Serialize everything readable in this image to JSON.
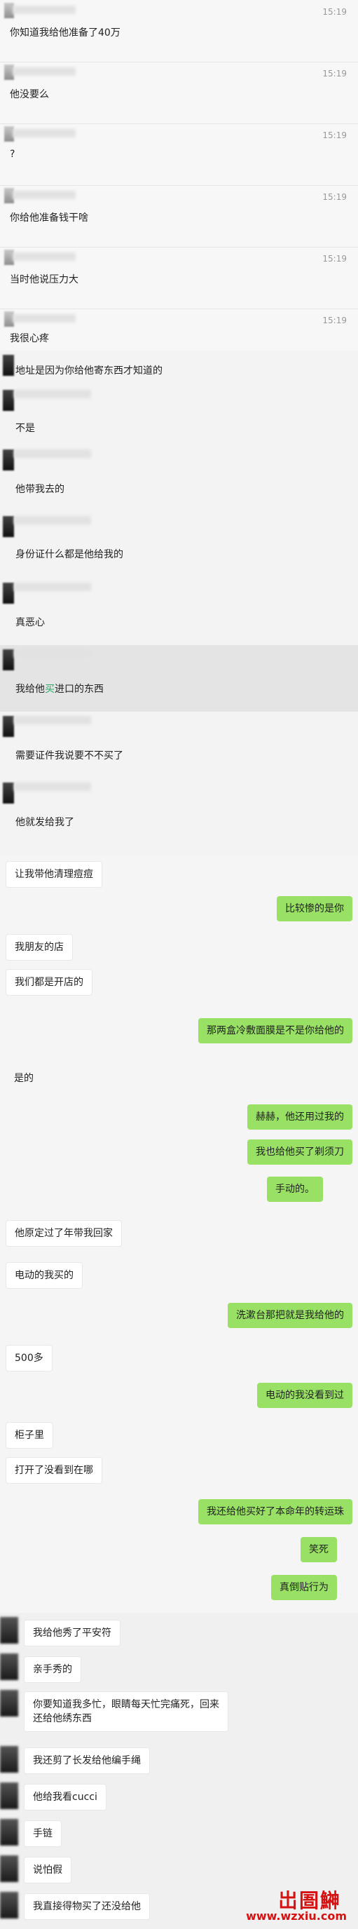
{
  "section1": [
    {
      "time": "15:19",
      "text": "你知道我给他准备了40万"
    },
    {
      "time": "15:19",
      "text": "他没要么"
    },
    {
      "time": "15:19",
      "text": "?"
    },
    {
      "time": "15:19",
      "text": "你给他准备钱干啥"
    },
    {
      "time": "15:19",
      "text": "当时他说压力大"
    },
    {
      "time": "15:19",
      "text": "我很心疼"
    }
  ],
  "section2": [
    {
      "text": "地址是因为你给他寄东西才知道的"
    },
    {
      "text": "不是"
    },
    {
      "text": "他带我去的"
    },
    {
      "text": "身份证什么都是他给我的"
    },
    {
      "text": "真恶心"
    },
    {
      "pre": "我给他",
      "accent": "买",
      "post": "进口的东西"
    },
    {
      "text": "需要证件我说要不不买了"
    },
    {
      "text": "他就发给我了"
    }
  ],
  "section3": [
    {
      "side": "l",
      "text": "让我带他清理痘痘"
    },
    {
      "side": "r",
      "text": "比较惨的是你"
    },
    {
      "side": "l",
      "text": "我朋友的店"
    },
    {
      "side": "l",
      "text": "我们都是开店的"
    },
    {
      "side": "r",
      "text": "那两盒冷敷面膜是不是你给他的"
    },
    {
      "side": "l",
      "text": "是的"
    },
    {
      "side": "r",
      "text": "赫赫，他还用过我的"
    },
    {
      "side": "r",
      "text": "我也给他买了剃须刀"
    },
    {
      "side": "r",
      "text": "手动的。"
    },
    {
      "side": "l",
      "text": "他原定过了年带我回家"
    },
    {
      "side": "l",
      "text": "电动的我买的"
    },
    {
      "side": "r",
      "text": "洗漱台那把就是我给他的"
    },
    {
      "side": "l",
      "text": "500多"
    },
    {
      "side": "r",
      "text": "电动的我没看到过"
    },
    {
      "side": "l",
      "text": "柜子里"
    },
    {
      "side": "l",
      "text": "打开了没看到在哪"
    },
    {
      "side": "r",
      "text": "我还给他买好了本命年的转运珠"
    },
    {
      "side": "r",
      "text": "笑死"
    },
    {
      "side": "r",
      "text": "真倒贴行为"
    }
  ],
  "section4": [
    {
      "text": "我给他秀了平安符"
    },
    {
      "text": "亲手秀的"
    },
    {
      "text": "你要知道我多忙，眼睛每天忙完痛死，回来\n还给他绣东西"
    },
    {
      "text": "我还剪了长发给他编手绳"
    },
    {
      "text": "他给我看cucci"
    },
    {
      "text": "手链"
    },
    {
      "text": "说怕假"
    },
    {
      "text": "我直接得物买了还没给他"
    }
  ],
  "watermark": {
    "name": "岀圄鰰",
    "url": "www.wzxiu.com"
  }
}
